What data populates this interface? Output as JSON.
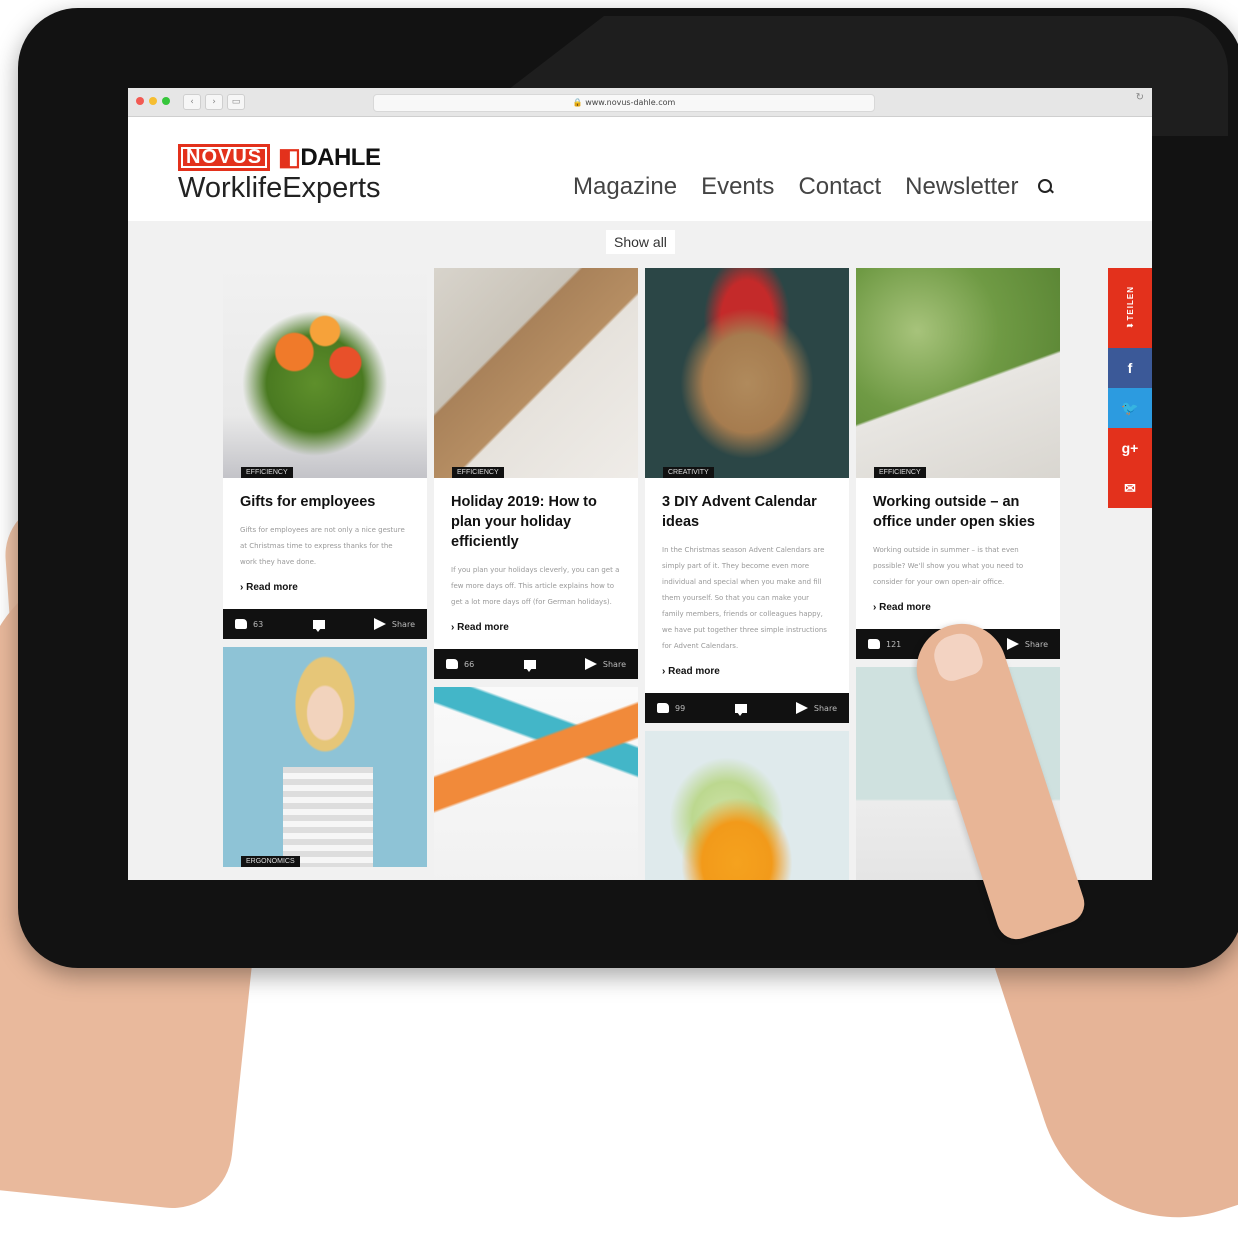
{
  "browser": {
    "url": "www.novus-dahle.com",
    "traffic_colors": [
      "#f25a53",
      "#f6be31",
      "#36c63b"
    ]
  },
  "header": {
    "brand_left": "NOVUS",
    "brand_right": "DAHLE",
    "tagline": "WorklifeExperts",
    "nav": [
      "Magazine",
      "Events",
      "Contact",
      "Newsletter"
    ]
  },
  "filter": {
    "show_all": "Show all"
  },
  "cards": [
    {
      "category": "EFFICIENCY",
      "title": "Gifts for employees",
      "excerpt": "Gifts for employees are not only a nice gesture at Christmas time to express thanks for the work they have done.",
      "read_more": "Read more",
      "likes": "63",
      "share": "Share"
    },
    {
      "category": "EFFICIENCY",
      "title": "Holiday 2019: How to plan your holiday efficiently",
      "excerpt": "If you plan your holidays cleverly, you can get a few more days off. This article explains how to get a lot more days off (for German holidays).",
      "read_more": "Read more",
      "likes": "66",
      "share": "Share"
    },
    {
      "category": "CREATIVITY",
      "title": "3 DIY Advent Calendar ideas",
      "excerpt": "In the Christmas season Advent Calendars are simply part of it. They become even more individual and special when you make and fill them yourself. So that you can make your family members, friends or colleagues happy, we have put together three simple instructions for Advent Calendars.",
      "read_more": "Read more",
      "likes": "99",
      "share": "Share"
    },
    {
      "category": "EFFICIENCY",
      "title": "Working outside – an office under open skies",
      "excerpt": "Working outside in summer – is that even possible? We'll show you what you need to consider for your own open-air office.",
      "read_more": "Read more",
      "likes": "121",
      "share": "Share"
    }
  ],
  "second_row": [
    {
      "category": "ERGONOMICS"
    },
    {
      "category": ""
    },
    {
      "category": ""
    },
    {
      "category": ""
    }
  ],
  "social": {
    "label": "TEILEN",
    "items": [
      "f",
      "t",
      "g+",
      "mail"
    ],
    "colors": {
      "teilen": "#e3311c",
      "facebook": "#3b5998",
      "twitter": "#2c9be0",
      "google": "#e3311c",
      "mail": "#e3311c"
    }
  }
}
